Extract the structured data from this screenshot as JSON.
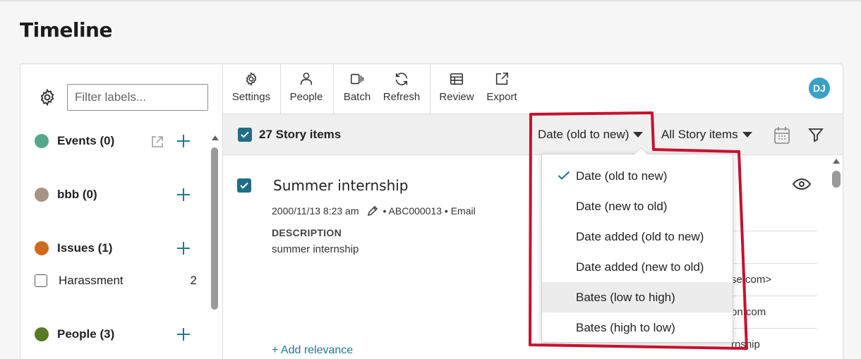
{
  "page": {
    "title": "Timeline"
  },
  "labels_panel": {
    "filter_placeholder": "Filter labels...",
    "groups": [
      {
        "label": "Events (0)",
        "color": "#55a68a"
      },
      {
        "label": "bbb (0)",
        "color": "#a89484"
      },
      {
        "label": "Issues (1)",
        "color": "#cf6a1c"
      },
      {
        "label": "People (3)",
        "color": "#5a7a23"
      }
    ],
    "sub_items": [
      {
        "label": "Harassment",
        "count": "2"
      }
    ]
  },
  "toolbar": {
    "settings": "Settings",
    "people": "People",
    "batch": "Batch",
    "refresh": "Refresh",
    "review": "Review",
    "export": "Export",
    "avatar_initials": "DJ"
  },
  "list_bar": {
    "count_label": "27 Story items",
    "sort_selected": "Date (old to new)",
    "filter_selected": "All Story items"
  },
  "story_item": {
    "title": "Summer internship",
    "timestamp": "2000/11/13 8:23 am",
    "meta": "• ABC000013 • Email",
    "description_label": "DESCRIPTION",
    "description": "summer internship",
    "add_relevance": "+ Add relevance",
    "right_fragments": [
      "se.com>",
      "on.com",
      "rnship"
    ]
  },
  "sort_menu": {
    "options": [
      {
        "label": "Date (old to new)",
        "selected": true
      },
      {
        "label": "Date (new to old)",
        "selected": false
      },
      {
        "label": "Date added (old to new)",
        "selected": false
      },
      {
        "label": "Date added (new to old)",
        "selected": false
      },
      {
        "label": "Bates (low to high)",
        "selected": false,
        "hovered": true
      },
      {
        "label": "Bates (high to low)",
        "selected": false
      }
    ]
  },
  "colors": {
    "accent": "#1f7a8c",
    "checkbox": "#1f6e87",
    "avatar": "#3aa0c8",
    "annotation": "#c8102e"
  }
}
